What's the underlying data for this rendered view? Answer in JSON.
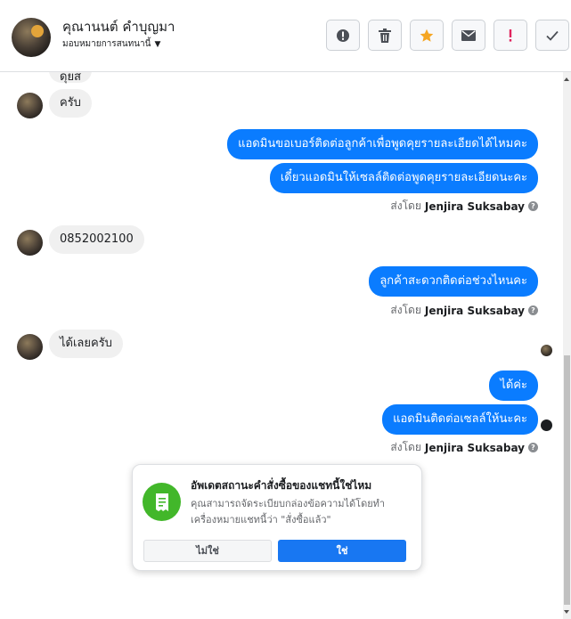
{
  "header": {
    "contact_name": "คุณานนต์ คำบุญมา",
    "assignee": "มอบหมายการสนทนานี้",
    "toolbar": {
      "report": "report-icon",
      "delete": "trash-icon",
      "star": "star-icon",
      "unread": "envelope-icon",
      "spam": "exclamation-icon",
      "done": "check-icon"
    }
  },
  "thread": {
    "partial_top_text": "ดุยส",
    "messages": [
      {
        "dir": "in",
        "text": "ครับ"
      },
      {
        "dir": "out",
        "text": "แอดมินขอเบอร์ติดต่อลูกค้าเพื่อพูดคุยรายละเอียดได้ไหมคะ"
      },
      {
        "dir": "out",
        "text": "เดี๋ยวแอดมินให้เซลล์ติดต่อพูดคุยรายละเอียดนะคะ"
      },
      {
        "dir": "in",
        "text": "0852002100"
      },
      {
        "dir": "out",
        "text": "ลูกค้าสะดวกติดต่อช่วงไหนคะ"
      },
      {
        "dir": "in",
        "text": "ได้เลยครับ"
      },
      {
        "dir": "out",
        "text": "ได้ค่ะ"
      },
      {
        "dir": "out",
        "text": "แอดมินติดต่อเซลล์ให้นะคะ"
      }
    ],
    "sent_by_prefix": "ส่งโดย",
    "sent_by_name": "Jenjira Suksabay",
    "help_glyph": "?"
  },
  "prompt_card": {
    "title": "อัพเดตสถานะคำสั่งซื้อของแชทนี้ใช่ไหม",
    "description": "คุณสามารถจัดระเบียบกล่องข้อความได้โดยทำเครื่องหมายแชทนี้ว่า \"สั่งซื้อแล้ว\"",
    "no_label": "ไม่ใช่",
    "yes_label": "ใช่",
    "icon": "receipt-icon",
    "icon_color": "#42b72a"
  },
  "colors": {
    "outgoing_bubble": "#0a7cff",
    "incoming_bubble": "#f0f0f0",
    "primary_button": "#1877f2",
    "star": "#f5a623"
  }
}
